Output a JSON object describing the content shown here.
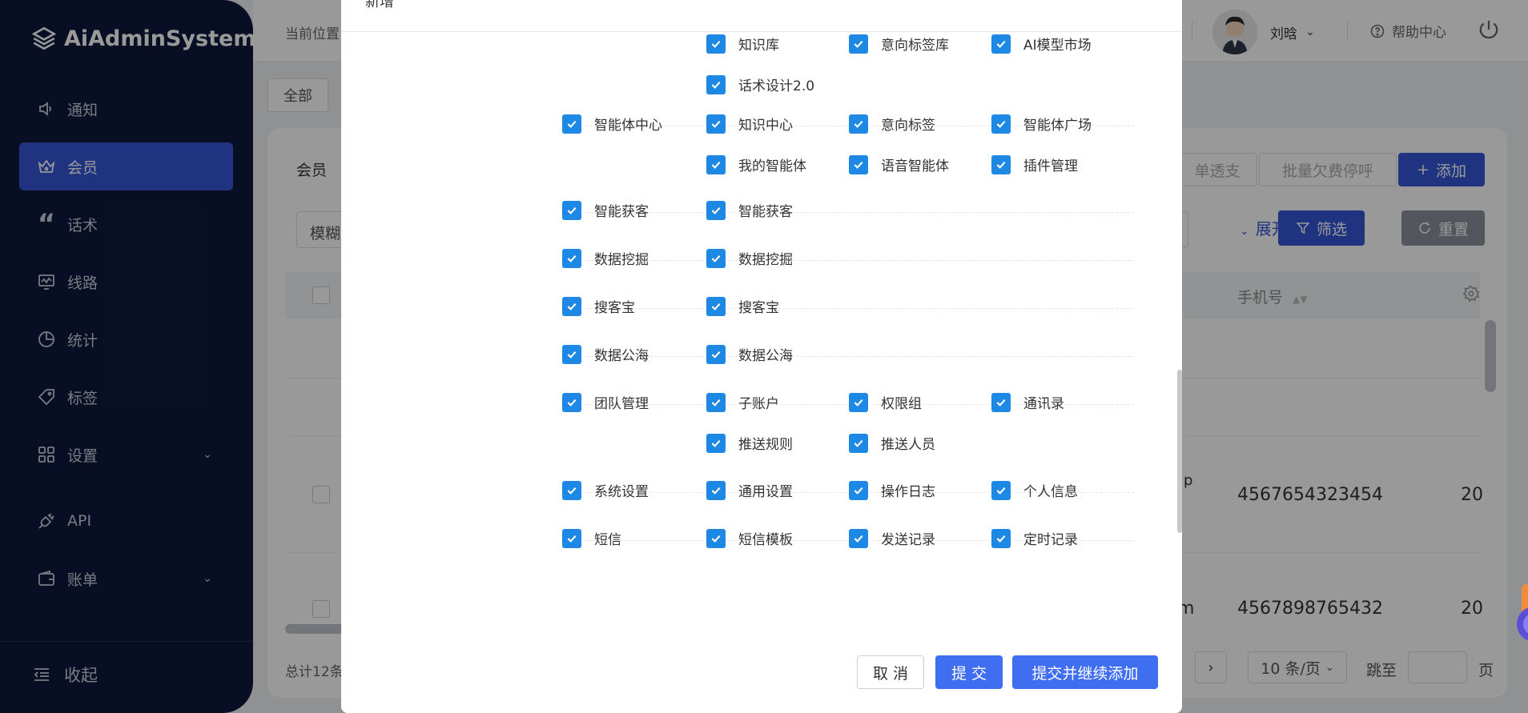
{
  "app": {
    "title": "AiAdminSystem"
  },
  "sidebar": {
    "items": [
      {
        "label": "通知",
        "icon": "speaker-icon"
      },
      {
        "label": "会员",
        "icon": "crown-icon",
        "active": true
      },
      {
        "label": "话术",
        "icon": "quote-icon"
      },
      {
        "label": "线路",
        "icon": "monitor-icon"
      },
      {
        "label": "统计",
        "icon": "pie-icon"
      },
      {
        "label": "标签",
        "icon": "tag-icon"
      },
      {
        "label": "设置",
        "icon": "grid-icon",
        "expandable": true
      },
      {
        "label": "API",
        "icon": "plug-icon"
      },
      {
        "label": "账单",
        "icon": "wallet-icon",
        "expandable": true
      }
    ],
    "collapse_label": "收起"
  },
  "header": {
    "breadcrumb": "当前位置",
    "user_name": "刘晗",
    "help_label": "帮助中心"
  },
  "content": {
    "filter_tag": "全部",
    "section_title": "会员",
    "search_mode": "模糊",
    "buttons": {
      "single_passthrough": "单透支",
      "batch_arrears": "批量欠费停呼",
      "add": "添加",
      "expand": "展开",
      "filter": "筛选",
      "reset": "重置"
    },
    "table": {
      "phone_header": "手机号",
      "rows": [
        {
          "partial": "p",
          "phone": "4567654323454",
          "date": "20"
        },
        {
          "partial": "m",
          "phone": "4567898765432",
          "date": "20"
        }
      ]
    },
    "pagination": {
      "total": "总计12条",
      "page_size": "10 条/页",
      "jump_label": "跳至",
      "page_label": "页"
    }
  },
  "modal": {
    "title": "新增",
    "rows": [
      {
        "parent": "",
        "children": [
          "知识库",
          "意向标签库",
          "AI模型市场",
          "话术设计2.0"
        ]
      },
      {
        "parent": "智能体中心",
        "children": [
          "知识中心",
          "意向标签",
          "智能体广场",
          "我的智能体",
          "语音智能体",
          "插件管理"
        ]
      },
      {
        "parent": "智能获客",
        "children": [
          "智能获客"
        ]
      },
      {
        "parent": "数据挖掘",
        "children": [
          "数据挖掘"
        ]
      },
      {
        "parent": "搜客宝",
        "children": [
          "搜客宝"
        ]
      },
      {
        "parent": "数据公海",
        "children": [
          "数据公海"
        ]
      },
      {
        "parent": "团队管理",
        "children": [
          "子账户",
          "权限组",
          "通讯录",
          "推送规则",
          "推送人员"
        ]
      },
      {
        "parent": "系统设置",
        "children": [
          "通用设置",
          "操作日志",
          "个人信息"
        ]
      },
      {
        "parent": "短信",
        "children": [
          "短信模板",
          "发送记录",
          "定时记录"
        ]
      }
    ],
    "cancel_label": "取 消",
    "submit_label": "提 交",
    "submit_more_label": "提交并继续添加"
  },
  "colors": {
    "sidebar_bg": "#0e1a3c",
    "accent": "#3656d6",
    "checkbox": "#1e88e5",
    "modal_primary": "#3f6ef0"
  }
}
